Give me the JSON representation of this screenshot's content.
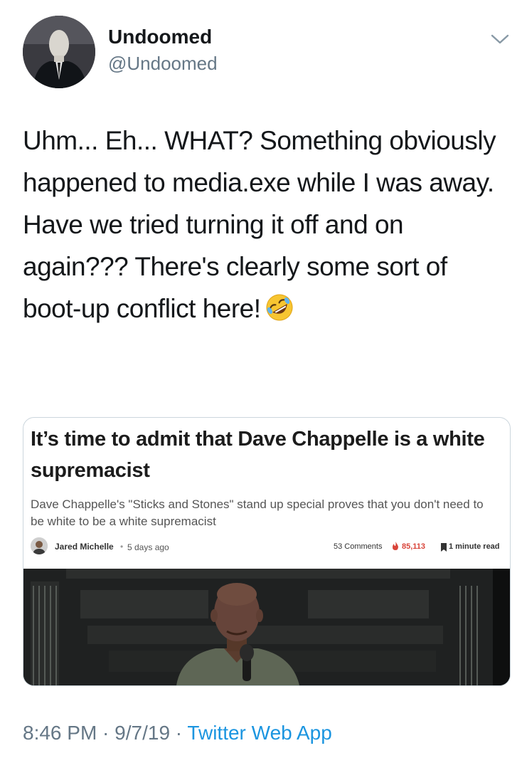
{
  "author": {
    "display_name": "Undoomed",
    "handle": "@Undoomed",
    "avatar_icon": "faceless-man-in-suit-avatar"
  },
  "menu": {
    "icon": "chevron-down-icon"
  },
  "tweet": {
    "text": "Uhm... Eh... WHAT? Something obviously happened to  media.exe while I was away. Have we tried turning it off and on again??? There's clearly some sort of boot-up conflict here!",
    "emoji": "rolling-on-floor-laughing-emoji"
  },
  "card": {
    "title": "It’s time to admit that Dave Chappelle is a white supremacist",
    "subtitle": "Dave Chappelle's \"Sticks and Stones\" stand up special proves that you don't need to be white to be a white supremacist",
    "author": "Jared Michelle",
    "separator": "•",
    "date": "5 days ago",
    "comments": "53 Comments",
    "views": "85,113",
    "read_time": "1 minute read",
    "image": "comedian-on-stage-photo",
    "views_color": "#d9443a"
  },
  "footer": {
    "time": "8:46 PM",
    "sep1": " · ",
    "date": "9/7/19",
    "sep2": " · ",
    "app": "Twitter Web App"
  },
  "colors": {
    "text": "#14171a",
    "secondary": "#657786",
    "link": "#1b95e0",
    "border": "#ccd6dd"
  }
}
